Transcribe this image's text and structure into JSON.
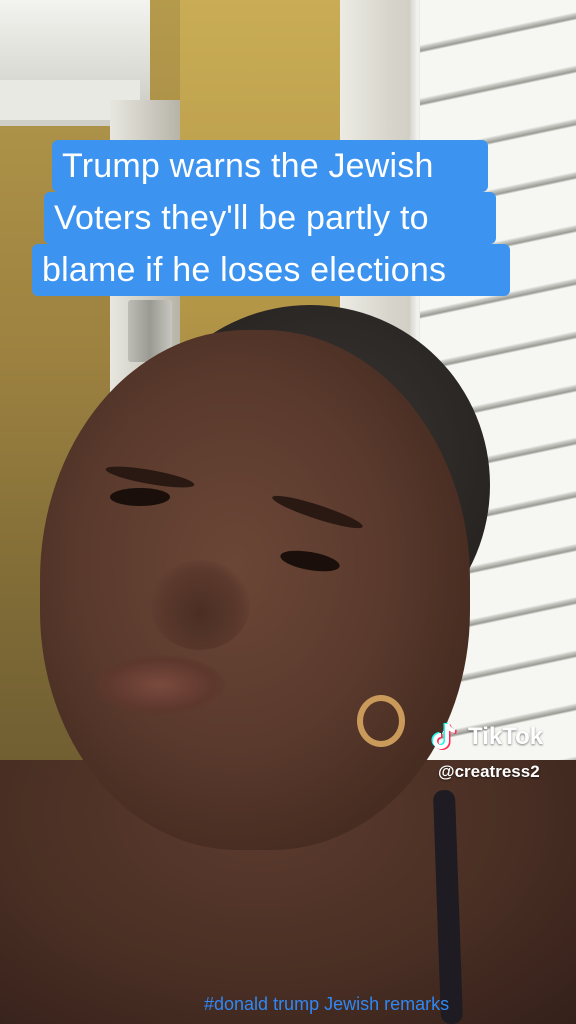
{
  "caption": {
    "line1": "Trump warns the Jewish",
    "line2": "Voters they'll be partly to",
    "line3": "blame if he loses elections",
    "background_color": "#3d94f0"
  },
  "watermark": {
    "brand": "TikTok",
    "logo_icon": "tiktok-note-icon",
    "handle": "@creatress2"
  },
  "footer": {
    "hashtag": "#donald trump Jewish remarks",
    "color": "#2f88f5"
  }
}
